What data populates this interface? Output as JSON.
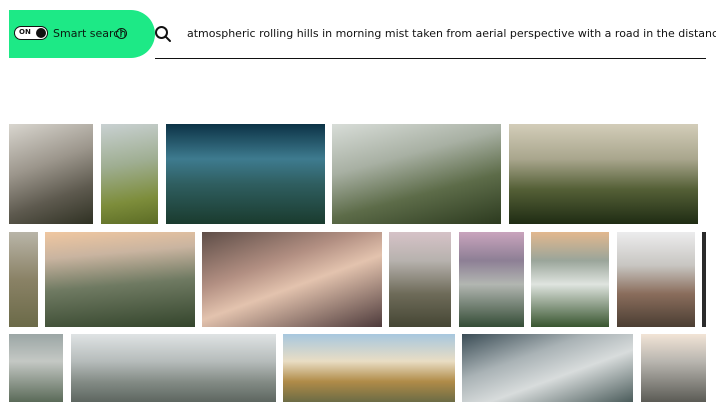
{
  "search": {
    "toggle_state": "ON",
    "smart_label": "Smart search",
    "help_glyph": "?",
    "search_icon": "search-icon",
    "query": "atmospheric rolling hills in morning mist taken from aerial perspective with a road in the distance"
  },
  "colors": {
    "smart_bg": "#1de986",
    "text": "#111111"
  },
  "results": [
    {
      "name": "result-1"
    },
    {
      "name": "result-2"
    },
    {
      "name": "result-3"
    },
    {
      "name": "result-4"
    },
    {
      "name": "result-5"
    },
    {
      "name": "result-6"
    },
    {
      "name": "result-7"
    },
    {
      "name": "result-8"
    },
    {
      "name": "result-9"
    },
    {
      "name": "result-10"
    },
    {
      "name": "result-11"
    },
    {
      "name": "result-12"
    },
    {
      "name": "result-13"
    },
    {
      "name": "result-14"
    },
    {
      "name": "result-15"
    },
    {
      "name": "result-16"
    },
    {
      "name": "result-17"
    },
    {
      "name": "result-18"
    },
    {
      "name": "result-19"
    }
  ]
}
